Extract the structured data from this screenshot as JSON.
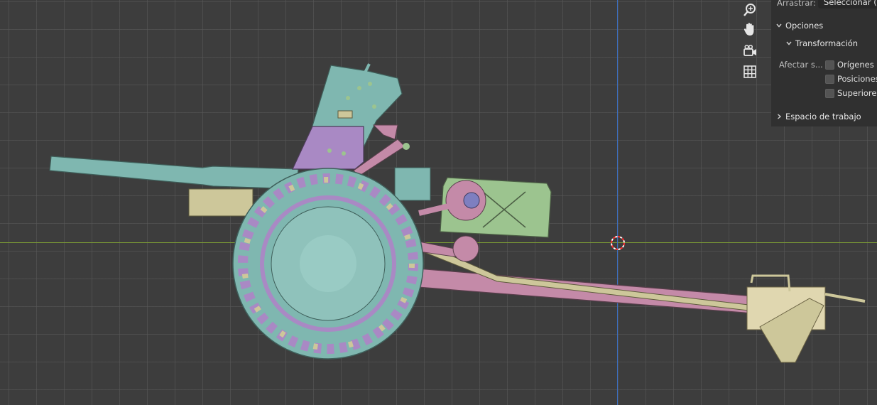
{
  "viewport": {
    "nav_icons": [
      "zoom-icon",
      "pan-hand-icon",
      "camera-view-icon",
      "orthographic-grid-icon"
    ],
    "colors": {
      "background": "#3d3d3d",
      "x_axis": "#7a9a35",
      "z_axis": "#3c6ec0",
      "model_teal": "#7fb7b0",
      "model_purple": "#a989c4",
      "model_pink": "#c48aa8",
      "model_green": "#9cc48f",
      "model_khaki": "#cdc79a"
    }
  },
  "panel": {
    "drag_label": "Arrastrar:",
    "drag_value": "Seleccionar (...",
    "options_label": "Opciones",
    "transform_label": "Transformación",
    "affect_label": "Afectar s...",
    "checkboxes": [
      {
        "label": "Orígenes",
        "checked": false
      },
      {
        "label": "Posiciones",
        "checked": false
      },
      {
        "label": "Superiores",
        "checked": false
      }
    ],
    "workspace_label": "Espacio de trabajo"
  }
}
